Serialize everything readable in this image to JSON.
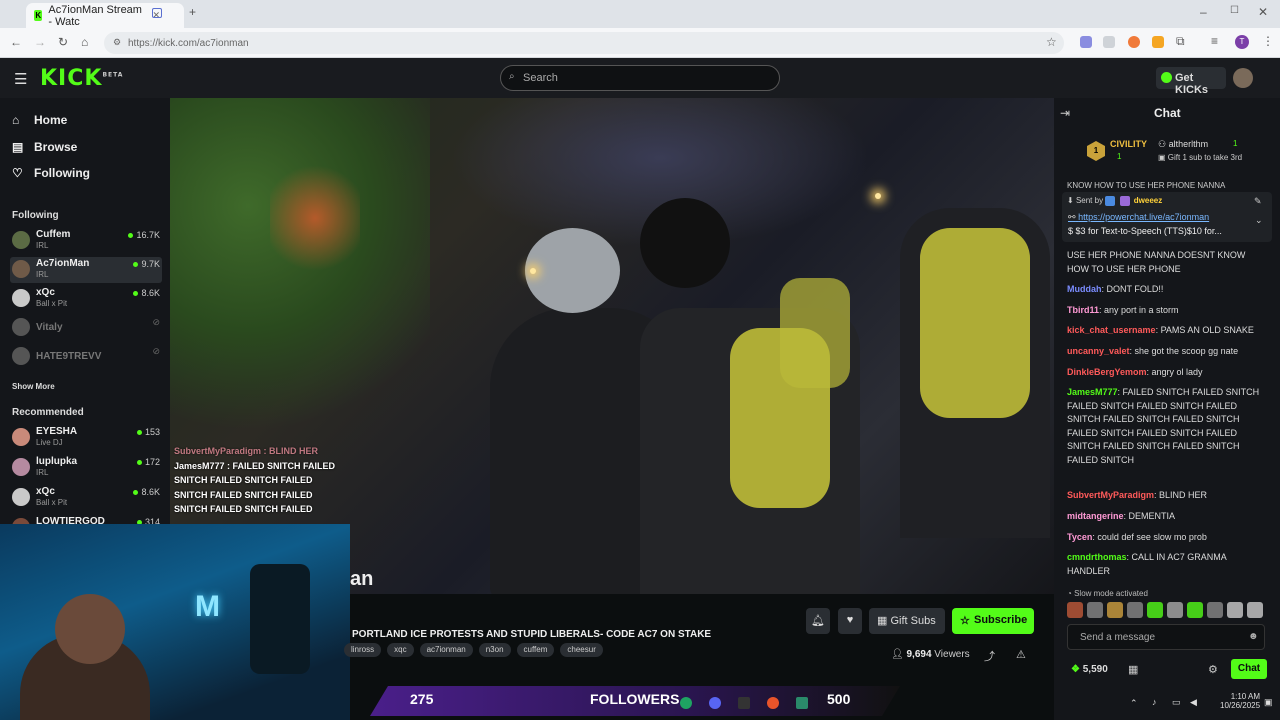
{
  "browser": {
    "tab_title": "Ac7ionMan Stream - Watc",
    "url": "https://kick.com/ac7ionman",
    "new_tab_icon": "plus-icon",
    "window_controls": [
      "minimize-icon",
      "maximize-icon",
      "close-icon"
    ]
  },
  "header": {
    "logo": "KICK",
    "logo_badge": "BETA",
    "search_placeholder": "Search",
    "get_kicks_label": "Get KICKs"
  },
  "sidebar": {
    "nav": [
      {
        "label": "Home",
        "icon": "home-icon"
      },
      {
        "label": "Browse",
        "icon": "browse-icon"
      },
      {
        "label": "Following",
        "icon": "heart-icon"
      }
    ],
    "following_title": "Following",
    "following": [
      {
        "name": "Cuffem",
        "category": "IRL",
        "viewers": "16.7K",
        "color": "#5b6b44"
      },
      {
        "name": "Ac7ionMan",
        "category": "IRL",
        "viewers": "9.7K",
        "color": "#6f5a48"
      },
      {
        "name": "xQc",
        "category": "Ball x Pit",
        "viewers": "8.6K",
        "color": "#c9c9c9"
      },
      {
        "name": "Vitaly",
        "category": "",
        "viewers": "",
        "color": "#555"
      },
      {
        "name": "HATE9TREVV",
        "category": "",
        "viewers": "",
        "color": "#555"
      }
    ],
    "show_more": "Show More",
    "recommended_title": "Recommended",
    "recommended": [
      {
        "name": "EYESHA",
        "category": "Live DJ",
        "viewers": "153",
        "color": "#c98a7a"
      },
      {
        "name": "luplupka",
        "category": "IRL",
        "viewers": "172",
        "color": "#b58aa0"
      },
      {
        "name": "xQc",
        "category": "Ball x Pit",
        "viewers": "8.6K",
        "color": "#c9c9c9"
      },
      {
        "name": "LOWTIERGOD",
        "category": "",
        "viewers": "314",
        "color": "#7a4a3a"
      }
    ]
  },
  "video_overlay": {
    "chat_lines": [
      "SubvertMyParadigm : BLIND HER",
      "JamesM777 : FAILED SNITCH   FAILED",
      "SNITCH   FAILED SNITCH   FAILED",
      "SNITCH   FAILED SNITCH   FAILED",
      "SNITCH   FAILED SNITCH   FAILED"
    ],
    "watermark": "an"
  },
  "stream": {
    "title": "PORTLAND ICE PROTESTS AND STUPID LIBERALS- CODE AC7 ON STAKE",
    "tags": [
      "linross",
      "xqc",
      "ac7ionman",
      "n3on",
      "cuffem",
      "cheesur"
    ],
    "viewers": "9,694",
    "viewers_label": "Viewers",
    "gift_subs_label": "Gift Subs",
    "subscribe_label": "Subscribe"
  },
  "overlay_bar": {
    "left_count": "275",
    "followers_label": "FOLLOWERS",
    "right_count": "500"
  },
  "chat": {
    "title": "Chat",
    "pinned": {
      "badge": "CIVILITY",
      "badge_count": "1",
      "user": "altherlthm",
      "user_count": "1",
      "gift_text": "Gift 1 sub to take 3rd"
    },
    "tts": {
      "header_text": "KNOW HOW TO USE HER PHONE NANNA",
      "sent_by": "Sent by",
      "sender": "dweeez",
      "link": "https://powerchat.live/ac7ionman",
      "price_text": "$3 for Text-to-Speech (TTS)$10 for..."
    },
    "messages": [
      {
        "user": "",
        "color": "#ddd",
        "text": "USE HER PHONE NANNA DOESNT KNOW HOW TO USE HER PHONE"
      },
      {
        "user": "Muddah",
        "color": "#7b8cff",
        "text": ": DONT FOLD!!"
      },
      {
        "user": "Tbird11",
        "color": "#ff9ad5",
        "text": ": any port in a storm"
      },
      {
        "user": "kick_chat_username",
        "color": "#ff5a5a",
        "text": ": PAMS AN OLD SNAKE"
      },
      {
        "user": "uncanny_valet",
        "color": "#ff5a5a",
        "text": ": she got the scoop gg nate"
      },
      {
        "user": "DinkleBergYemom",
        "color": "#ff5a5a",
        "text": ": angry ol lady"
      },
      {
        "user": "JamesM777",
        "color": "#53fc18",
        "text": ": FAILED SNITCH   FAILED SNITCH   FAILED SNITCH   FAILED SNITCH   FAILED SNITCH   FAILED SNITCH   FAILED SNITCH   FAILED SNITCH   FAILED SNITCH   FAILED SNITCH   FAILED SNITCH   FAILED SNITCH   FAILED SNITCH"
      },
      {
        "user": "SubvertMyParadigm",
        "color": "#ff5a5a",
        "text": ": BLIND HER"
      },
      {
        "user": "midtangerine",
        "color": "#ff9ad5",
        "text": ": DEMENTIA"
      },
      {
        "user": "Tycen",
        "color": "#ff9ad5",
        "text": ": could def see slow mo prob"
      },
      {
        "user": "cmndrthomas",
        "color": "#53fc18",
        "text": ": CALL IN AC7 GRANMA HANDLER"
      }
    ],
    "slow_mode": "Slow mode activated",
    "input_placeholder": "Send a message",
    "points": "5,590",
    "send_label": "Chat"
  },
  "taskbar": {
    "time": "1:10 AM",
    "date": "10/26/2025"
  }
}
